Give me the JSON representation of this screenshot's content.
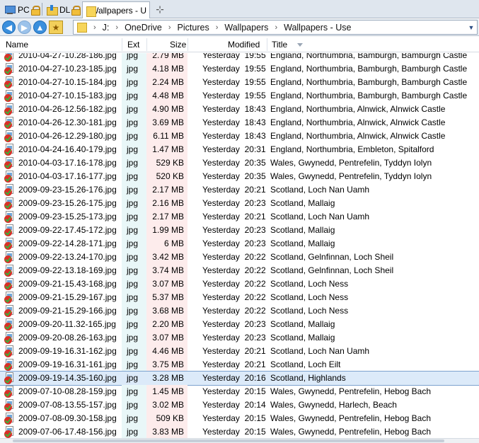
{
  "tabs": [
    {
      "label": "PC",
      "icon": "computer-icon",
      "locked": true
    },
    {
      "label": "DL",
      "icon": "downloads-folder-icon",
      "locked": true
    },
    {
      "label": "Wallpapers - U",
      "icon": "folder-icon",
      "active": true
    }
  ],
  "address": {
    "crumbs": [
      "J:",
      "OneDrive",
      "Pictures",
      "Wallpapers",
      "Wallpapers - Use"
    ]
  },
  "columns": {
    "name": "Name",
    "ext": "Ext",
    "size": "Size",
    "modified": "Modified",
    "title": "Title"
  },
  "rows": [
    {
      "name": "2010-04-27-10.28-186.jpg",
      "ext": "jpg",
      "size": "2.79 MB",
      "modified": "Yesterday  19:55",
      "title": "England, Northumbria, Bamburgh, Bamburgh Castle"
    },
    {
      "name": "2010-04-27-10.23-185.jpg",
      "ext": "jpg",
      "size": "4.18 MB",
      "modified": "Yesterday  19:55",
      "title": "England, Northumbria, Bamburgh, Bamburgh Castle"
    },
    {
      "name": "2010-04-27-10.15-184.jpg",
      "ext": "jpg",
      "size": "2.24 MB",
      "modified": "Yesterday  19:55",
      "title": "England, Northumbria, Bamburgh, Bamburgh Castle"
    },
    {
      "name": "2010-04-27-10.15-183.jpg",
      "ext": "jpg",
      "size": "4.48 MB",
      "modified": "Yesterday  19:55",
      "title": "England, Northumbria, Bamburgh, Bamburgh Castle"
    },
    {
      "name": "2010-04-26-12.56-182.jpg",
      "ext": "jpg",
      "size": "4.90 MB",
      "modified": "Yesterday  18:43",
      "title": "England, Northumbria, Alnwick, Alnwick Castle"
    },
    {
      "name": "2010-04-26-12.30-181.jpg",
      "ext": "jpg",
      "size": "3.69 MB",
      "modified": "Yesterday  18:43",
      "title": "England, Northumbria, Alnwick, Alnwick Castle"
    },
    {
      "name": "2010-04-26-12.29-180.jpg",
      "ext": "jpg",
      "size": "6.11 MB",
      "modified": "Yesterday  18:43",
      "title": "England, Northumbria, Alnwick, Alnwick Castle"
    },
    {
      "name": "2010-04-24-16.40-179.jpg",
      "ext": "jpg",
      "size": "1.47 MB",
      "modified": "Yesterday  20:31",
      "title": "England, Northumbria, Embleton, Spitalford"
    },
    {
      "name": "2010-04-03-17.16-178.jpg",
      "ext": "jpg",
      "size": "529 KB",
      "modified": "Yesterday  20:35",
      "title": "Wales, Gwynedd, Pentrefelin, Tyddyn Iolyn"
    },
    {
      "name": "2010-04-03-17.16-177.jpg",
      "ext": "jpg",
      "size": "520 KB",
      "modified": "Yesterday  20:35",
      "title": "Wales, Gwynedd, Pentrefelin, Tyddyn Iolyn"
    },
    {
      "name": "2009-09-23-15.26-176.jpg",
      "ext": "jpg",
      "size": "2.17 MB",
      "modified": "Yesterday  20:21",
      "title": "Scotland, Loch Nan Uamh"
    },
    {
      "name": "2009-09-23-15.26-175.jpg",
      "ext": "jpg",
      "size": "2.16 MB",
      "modified": "Yesterday  20:23",
      "title": "Scotland, Mallaig"
    },
    {
      "name": "2009-09-23-15.25-173.jpg",
      "ext": "jpg",
      "size": "2.17 MB",
      "modified": "Yesterday  20:21",
      "title": "Scotland, Loch Nan Uamh"
    },
    {
      "name": "2009-09-22-17.45-172.jpg",
      "ext": "jpg",
      "size": "1.99 MB",
      "modified": "Yesterday  20:23",
      "title": "Scotland, Mallaig"
    },
    {
      "name": "2009-09-22-14.28-171.jpg",
      "ext": "jpg",
      "size": "6 MB",
      "modified": "Yesterday  20:23",
      "title": "Scotland, Mallaig"
    },
    {
      "name": "2009-09-22-13.24-170.jpg",
      "ext": "jpg",
      "size": "3.42 MB",
      "modified": "Yesterday  20:22",
      "title": "Scotland, Gelnfinnan, Loch Sheil"
    },
    {
      "name": "2009-09-22-13.18-169.jpg",
      "ext": "jpg",
      "size": "3.74 MB",
      "modified": "Yesterday  20:22",
      "title": "Scotland, Gelnfinnan, Loch Sheil"
    },
    {
      "name": "2009-09-21-15.43-168.jpg",
      "ext": "jpg",
      "size": "3.07 MB",
      "modified": "Yesterday  20:22",
      "title": "Scotland, Loch Ness"
    },
    {
      "name": "2009-09-21-15.29-167.jpg",
      "ext": "jpg",
      "size": "5.37 MB",
      "modified": "Yesterday  20:22",
      "title": "Scotland, Loch Ness"
    },
    {
      "name": "2009-09-21-15.29-166.jpg",
      "ext": "jpg",
      "size": "3.68 MB",
      "modified": "Yesterday  20:22",
      "title": "Scotland, Loch Ness"
    },
    {
      "name": "2009-09-20-11.32-165.jpg",
      "ext": "jpg",
      "size": "2.20 MB",
      "modified": "Yesterday  20:23",
      "title": "Scotland, Mallaig"
    },
    {
      "name": "2009-09-20-08.26-163.jpg",
      "ext": "jpg",
      "size": "3.07 MB",
      "modified": "Yesterday  20:23",
      "title": "Scotland, Mallaig"
    },
    {
      "name": "2009-09-19-16.31-162.jpg",
      "ext": "jpg",
      "size": "4.46 MB",
      "modified": "Yesterday  20:21",
      "title": "Scotland, Loch Nan Uamh"
    },
    {
      "name": "2009-09-19-16.31-161.jpg",
      "ext": "jpg",
      "size": "3.75 MB",
      "modified": "Yesterday  20:21",
      "title": "Scotland, Loch Eilt"
    },
    {
      "name": "2009-09-19-14.35-160.jpg",
      "ext": "jpg",
      "size": "3.28 MB",
      "modified": "Yesterday  20:16",
      "title": "Scotland, Highlands",
      "selected": true
    },
    {
      "name": "2009-07-10-08.28-159.jpg",
      "ext": "jpg",
      "size": "1.45 MB",
      "modified": "Yesterday  20:15",
      "title": "Wales, Gwynedd, Pentrefelin, Hebog Bach"
    },
    {
      "name": "2009-07-08-13.55-157.jpg",
      "ext": "jpg",
      "size": "3.02 MB",
      "modified": "Yesterday  20:14",
      "title": "Wales, Gwynedd, Harlech, Beach"
    },
    {
      "name": "2009-07-08-09.30-158.jpg",
      "ext": "jpg",
      "size": "509 KB",
      "modified": "Yesterday  20:15",
      "title": "Wales, Gwynedd, Pentrefelin, Hebog Bach"
    },
    {
      "name": "2009-07-06-17.48-156.jpg",
      "ext": "jpg",
      "size": "3.83 MB",
      "modified": "Yesterday  20:15",
      "title": "Wales, Gwynedd, Pentrefelin, Hebog Bach"
    }
  ],
  "colors": {
    "ext_band": "#e9f7f8",
    "size_band": "#fdecec",
    "selection": "#dceaf9"
  }
}
